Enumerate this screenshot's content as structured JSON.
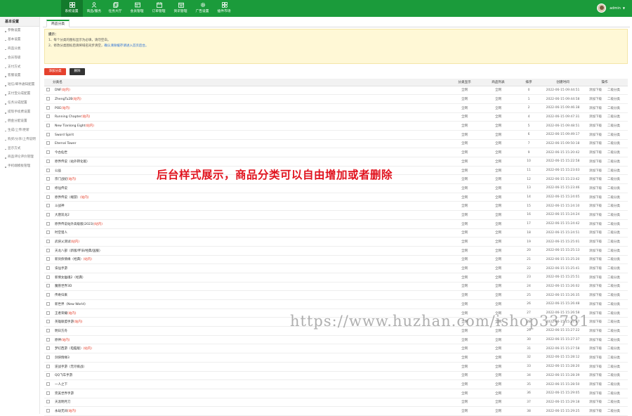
{
  "topnav": {
    "items": [
      {
        "label": "系统设置",
        "icon": "grid-icon",
        "active": true
      },
      {
        "label": "商品/服务",
        "icon": "user-icon",
        "active": false
      },
      {
        "label": "任务大厅",
        "icon": "copy-icon",
        "active": false
      },
      {
        "label": "会员管理",
        "icon": "users-icon",
        "active": false
      },
      {
        "label": "订单管理",
        "icon": "calendar-icon",
        "active": false
      },
      {
        "label": "资讯管理",
        "icon": "calendar-list-icon",
        "active": false
      },
      {
        "label": "广告设置",
        "icon": "gear-icon",
        "active": false
      },
      {
        "label": "插件市场",
        "icon": "plugin-icon",
        "active": false
      }
    ],
    "user": {
      "name": "admin"
    }
  },
  "sidebar": {
    "title": "基本设置",
    "items": [
      "参数设置",
      "基本设置",
      "商品分类",
      "会员等级",
      "支付方式",
      "客服设置",
      "短信/邮件通知配置",
      "支付宝分成配置",
      "任务分成配置",
      "提现手续费设置",
      "佣金分配设置",
      "生成/上传/更新",
      "购买/分享/上传说明",
      "显示方式",
      "商品评论评价管理",
      "手机端模板管理"
    ]
  },
  "tab": {
    "label": "商品分类"
  },
  "notice": {
    "title": "提示：",
    "line1": "1、每个分类的图标显示为必填，请勿空白。",
    "line2": "2、修改分类图标后请将域名同步清空，",
    "link": "确认清除缓存请进入首页后台。"
  },
  "buttons": {
    "add": "添加分类",
    "delete": "删除"
  },
  "table": {
    "headers": {
      "name": "分类名",
      "col2": "分类显示",
      "col3": "商品列表",
      "col4": "排序",
      "col5": "创建时间",
      "col6": "操作"
    },
    "ops": {
      "edit": "添加下级",
      "del": "二级分类"
    },
    "rows": [
      {
        "name": "DNF",
        "tag": "(站内)",
        "c2": "全网",
        "c3": "全网",
        "order": "0",
        "time": "2022-06-15 09:44:51"
      },
      {
        "name": "ZhengTu2B",
        "tag": "(站内)",
        "c2": "全网",
        "c3": "全网",
        "order": "1",
        "time": "2022-06-15 09:44:58"
      },
      {
        "name": "POE",
        "tag": "(站内)",
        "c2": "全网",
        "c3": "全网",
        "order": "2",
        "time": "2022-06-15 09:46:38"
      },
      {
        "name": "Running Chapter",
        "tag": "(站内)",
        "c2": "全网",
        "c3": "全网",
        "order": "4",
        "time": "2022-06-15 09:47:31"
      },
      {
        "name": "New Tianlong Eight",
        "tag": "(站内)",
        "c2": "全网",
        "c3": "全网",
        "order": "5",
        "time": "2022-06-15 09:48:51"
      },
      {
        "name": "Sword Spirit",
        "tag": "",
        "c2": "全网",
        "c3": "全网",
        "order": "6",
        "time": "2022-06-15 09:49:17"
      },
      {
        "name": "Eternal Tower",
        "tag": "",
        "c2": "全网",
        "c3": "全网",
        "order": "7",
        "time": "2022-06-15 09:50:18"
      },
      {
        "name": "今古仙世",
        "tag": "",
        "c2": "全网",
        "c3": "全网",
        "order": "9",
        "time": "2022-06-15 15:20:42"
      },
      {
        "name": "原界传说（站外转化版）",
        "tag": "",
        "c2": "全网",
        "c3": "全网",
        "order": "10",
        "time": "2022-06-15 15:22:58"
      },
      {
        "name": "公益",
        "tag": "",
        "c2": "全网",
        "c3": "全网",
        "order": "11",
        "time": "2022-06-15 15:23:03"
      },
      {
        "name": "宗门战纪",
        "tag": "(站内)",
        "c2": "全网",
        "c3": "全网",
        "order": "12",
        "time": "2022-06-15 15:23:42"
      },
      {
        "name": "修仙传说",
        "tag": "",
        "c2": "全网",
        "c3": "全网",
        "order": "13",
        "time": "2022-06-15 15:23:46"
      },
      {
        "name": "原界传说（端游）",
        "tag": "(站内)",
        "c2": "全网",
        "c3": "全网",
        "order": "14",
        "time": "2022-06-15 15:24:05"
      },
      {
        "name": "斗战神",
        "tag": "",
        "c2": "全网",
        "c3": "全网",
        "order": "15",
        "time": "2022-06-15 15:24:10"
      },
      {
        "name": "大唐双龙2",
        "tag": "",
        "c2": "全网",
        "c3": "全网",
        "order": "16",
        "time": "2022-06-15 15:24:24"
      },
      {
        "name": "原界传说站外高级版(2023)",
        "tag": "(站内)",
        "c2": "全网",
        "c3": "全网",
        "order": "17",
        "time": "2022-06-15 15:24:42"
      },
      {
        "name": "时空猎人",
        "tag": "",
        "c2": "全网",
        "c3": "全网",
        "order": "18",
        "time": "2022-06-15 15:24:51"
      },
      {
        "name": "武侠乂测试",
        "tag": "(站内)",
        "c2": "全网",
        "c3": "全网",
        "order": "19",
        "time": "2022-06-15 15:25:01"
      },
      {
        "name": "天龙八部（新版/怀旧/经典/国服）",
        "tag": "",
        "c2": "全网",
        "c3": "全网",
        "order": "20",
        "time": "2022-06-15 15:25:13"
      },
      {
        "name": "新剑侠情缘（经典）",
        "tag": "(站内)",
        "c2": "全网",
        "c3": "全网",
        "order": "21",
        "time": "2022-06-15 15:25:20"
      },
      {
        "name": "诛仙手游",
        "tag": "",
        "c2": "全网",
        "c3": "全网",
        "order": "22",
        "time": "2022-06-15 15:25:41"
      },
      {
        "name": "新倩女幽魂2（经典）",
        "tag": "",
        "c2": "全网",
        "c3": "全网",
        "order": "23",
        "time": "2022-06-15 15:25:51"
      },
      {
        "name": "魔兽世界3D",
        "tag": "",
        "c2": "全网",
        "c3": "全网",
        "order": "24",
        "time": "2022-06-15 15:26:02"
      },
      {
        "name": "传奇归来",
        "tag": "",
        "c2": "全网",
        "c3": "全网",
        "order": "25",
        "time": "2022-06-15 15:26:35"
      },
      {
        "name": "新世界（New World）",
        "tag": "",
        "c2": "全网",
        "c3": "全网",
        "order": "26",
        "time": "2022-06-15 15:26:48"
      },
      {
        "name": "王者荣耀",
        "tag": "(站内)",
        "c2": "全网",
        "c3": "全网",
        "order": "27",
        "time": "2022-06-15 15:26:58"
      },
      {
        "name": "英雄联盟手游",
        "tag": "(站内)",
        "c2": "全网",
        "c3": "全网",
        "order": "28",
        "time": "2022-06-15 15:27:07"
      },
      {
        "name": "明日方舟",
        "tag": "",
        "c2": "全网",
        "c3": "全网",
        "order": "29",
        "time": "2022-06-15 15:27:22"
      },
      {
        "name": "原神",
        "tag": "(站内)",
        "c2": "全网",
        "c3": "全网",
        "order": "30",
        "time": "2022-06-15 15:27:37"
      },
      {
        "name": "梦幻西游（电脑版）",
        "tag": "(站内)",
        "c2": "全网",
        "c3": "全网",
        "order": "31",
        "time": "2022-06-15 15:27:58"
      },
      {
        "name": "剑侠情缘3",
        "tag": "",
        "c2": "全网",
        "c3": "全网",
        "order": "32",
        "time": "2022-06-15 15:28:12"
      },
      {
        "name": "逆战手游（无尽挑战）",
        "tag": "",
        "c2": "全网",
        "c3": "全网",
        "order": "33",
        "time": "2022-06-15 15:28:20"
      },
      {
        "name": "QQ飞车手游",
        "tag": "",
        "c2": "全网",
        "c3": "全网",
        "order": "34",
        "time": "2022-06-15 15:28:39"
      },
      {
        "name": "一人之下",
        "tag": "",
        "c2": "全网",
        "c3": "全网",
        "order": "35",
        "time": "2022-06-15 15:28:50"
      },
      {
        "name": "完美世界手游",
        "tag": "",
        "c2": "全网",
        "c3": "全网",
        "order": "36",
        "time": "2022-06-15 15:29:05"
      },
      {
        "name": "天涯明月刀",
        "tag": "",
        "c2": "全网",
        "c3": "全网",
        "order": "37",
        "time": "2022-06-15 15:29:18"
      },
      {
        "name": "永劫无间",
        "tag": "(站内)",
        "c2": "全网",
        "c3": "全网",
        "order": "38",
        "time": "2022-06-15 15:29:25"
      }
    ]
  },
  "overlay_text": "后台样式展示，商品分类可以自由增加或者删除",
  "watermark": "https://www.huzhan.com/ishop33781"
}
